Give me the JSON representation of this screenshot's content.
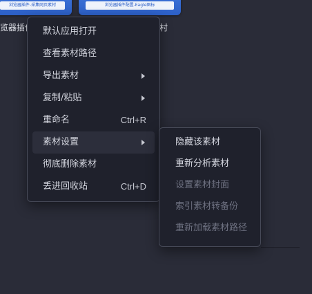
{
  "background": {
    "thumbnails": [
      {
        "caption": "览器插件",
        "banner_text": "浏览器插件-采集网页素材"
      },
      {
        "caption": "村",
        "banner_text": "浏览器插件配置-Eagle图标"
      }
    ]
  },
  "context_menu": {
    "items": [
      {
        "label": "默认应用打开",
        "shortcut": "",
        "submenu": false
      },
      {
        "label": "查看素材路径",
        "shortcut": "",
        "submenu": false
      },
      {
        "label": "导出素材",
        "shortcut": "",
        "submenu": true
      },
      {
        "label": "复制/粘贴",
        "shortcut": "",
        "submenu": true
      },
      {
        "label": "重命名",
        "shortcut": "Ctrl+R",
        "submenu": false
      },
      {
        "label": "素材设置",
        "shortcut": "",
        "submenu": true,
        "active": true
      },
      {
        "label": "彻底删除素材",
        "shortcut": "",
        "submenu": false
      },
      {
        "label": "丢进回收站",
        "shortcut": "Ctrl+D",
        "submenu": false
      }
    ]
  },
  "submenu": {
    "items": [
      {
        "label": "隐藏该素材",
        "enabled": true
      },
      {
        "label": "重新分析素材",
        "enabled": true
      },
      {
        "label": "设置素材封面",
        "enabled": false
      },
      {
        "label": "索引素材转备份",
        "enabled": false
      },
      {
        "label": "重新加载素材路径",
        "enabled": false
      }
    ]
  },
  "colors": {
    "menu_bg": "#1f212c",
    "page_bg": "#2a2c38",
    "thumbnail_blue": "#3d74d9",
    "disabled_text": "#6e7181"
  }
}
